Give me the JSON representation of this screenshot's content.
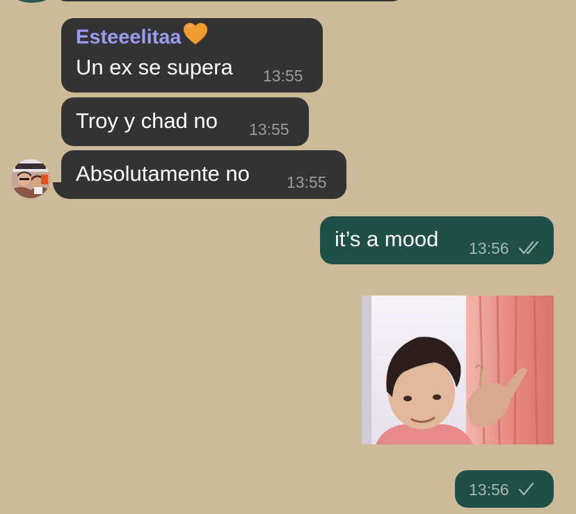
{
  "conversation": {
    "messages": [
      {
        "direction": "incoming",
        "sender": "Esteeelitaa",
        "sender_color": "#9a9cf2",
        "emoji": "orange-heart",
        "text": "Un ex se supera",
        "time": "13:55"
      },
      {
        "direction": "incoming",
        "text": "Troy y chad no",
        "time": "13:55"
      },
      {
        "direction": "incoming",
        "text": "Absolutamente no",
        "time": "13:55",
        "avatar": "sender-avatar"
      },
      {
        "direction": "outgoing",
        "text": "it’s a mood",
        "time": "13:56",
        "status": "double-check-icon"
      },
      {
        "direction": "outgoing",
        "attachment": "photo",
        "status": "none"
      },
      {
        "direction": "outgoing",
        "text": "",
        "time": "13:56",
        "status": "single-check-icon"
      }
    ]
  },
  "colors": {
    "background": "#cbbb99",
    "incoming_bubble": "#333333",
    "outgoing_bubble": "#1f4f46",
    "sender_name": "#9a9cf2"
  }
}
